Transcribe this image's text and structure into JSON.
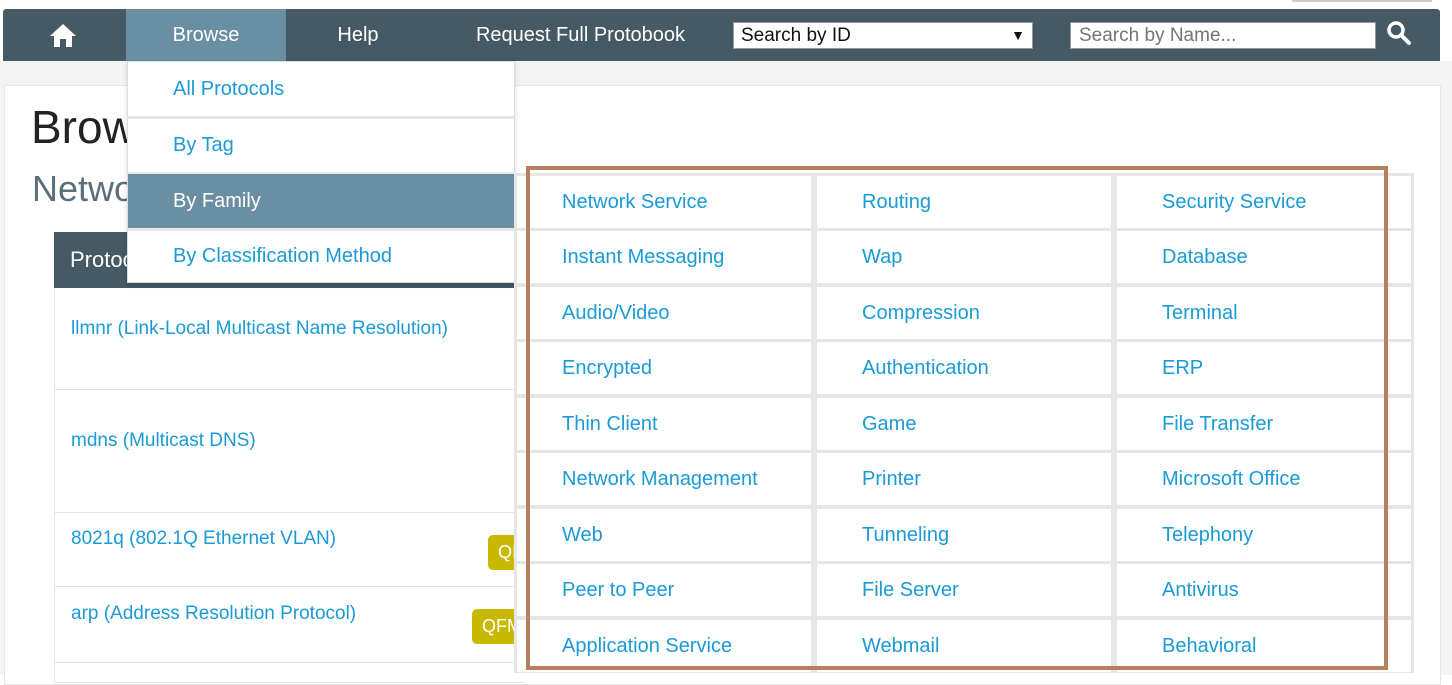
{
  "navbar": {
    "home_icon": "home-icon",
    "browse_label": "Browse",
    "help_label": "Help",
    "request_label": "Request Full Protobook",
    "search_by_id": "Search by ID",
    "search_by_id_arrow": "▼",
    "search_name_placeholder": "Search by Name...",
    "search_icon": "search-icon"
  },
  "page": {
    "title": "Brow",
    "subtitle": "Netwo"
  },
  "table": {
    "header": "Protoc",
    "rows": [
      {
        "name": "llmnr (Link-Local Multicast Name Resolution)",
        "badge": ""
      },
      {
        "name": "mdns (Multicast DNS)",
        "badge": ""
      },
      {
        "name": "8021q (802.1Q Ethernet VLAN)",
        "badge": "QI"
      },
      {
        "name": "arp (Address Resolution Protocol)",
        "badge": "QFM"
      }
    ]
  },
  "dropdown": {
    "items": [
      "All Protocols",
      "By Tag",
      "By Family",
      "By Classification Method"
    ],
    "active": "By Family"
  },
  "families": [
    [
      "Network Service",
      "Routing",
      "Security Service"
    ],
    [
      "Instant Messaging",
      "Wap",
      "Database"
    ],
    [
      "Audio/Video",
      "Compression",
      "Terminal"
    ],
    [
      "Encrypted",
      "Authentication",
      "ERP"
    ],
    [
      "Thin Client",
      "Game",
      "File Transfer"
    ],
    [
      "Network Management",
      "Printer",
      "Microsoft Office"
    ],
    [
      "Web",
      "Tunneling",
      "Telephony"
    ],
    [
      "Peer to Peer",
      "File Server",
      "Antivirus"
    ],
    [
      "Application Service",
      "Webmail",
      "Behavioral"
    ]
  ],
  "colors": {
    "navbar": "#455a64",
    "active": "#6a8fa3",
    "link": "#1a9ad6",
    "highlight": "#b5815a",
    "badge": "#c8b800"
  }
}
